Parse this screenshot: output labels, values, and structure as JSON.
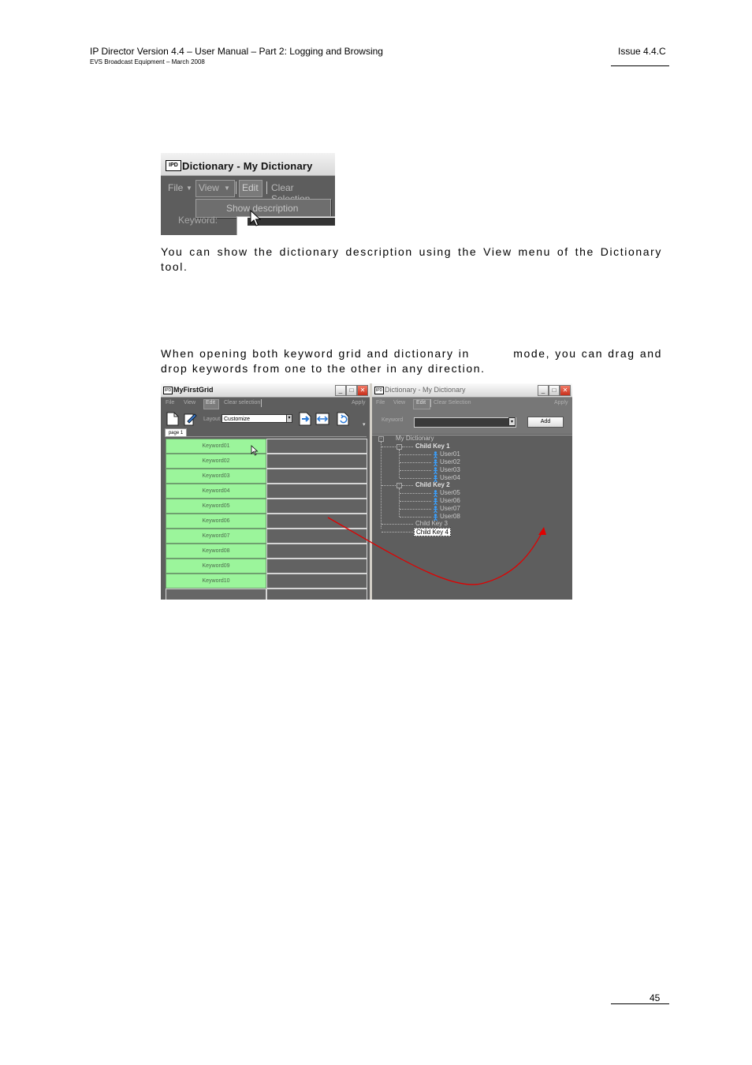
{
  "header": {
    "title": "IP Director Version 4.4 – User Manual – Part 2: Logging and Browsing",
    "subtitle": "EVS Broadcast Equipment – March 2008",
    "issue": "Issue 4.4.C"
  },
  "screenshot1": {
    "window_title": "Dictionary - My Dictionary",
    "logo_text": "IPD",
    "menu": {
      "file": "File",
      "view": "View",
      "edit": "Edit",
      "clear_selection": "Clear Selection"
    },
    "dropdown_item": "Show description",
    "keyword_label": "Keyword:"
  },
  "paragraph1": "You can show the dictionary description using the View menu of the Dictionary tool.",
  "paragraph2": "When opening both keyword grid and dictionary in         mode, you can drag and drop keywords from one to the other in any direction.",
  "screenshot2": {
    "grid_window": {
      "title": "MyFirstGrid",
      "menu": {
        "file": "File",
        "view": "View",
        "edit": "Edit",
        "clear_selection": "Clear selection",
        "apply": "Apply"
      },
      "layout_label": "Layout",
      "layout_value": "Customize",
      "page_tab": "page 1",
      "keywords": [
        "Keyword01",
        "Keyword02",
        "Keyword03",
        "Keyword04",
        "Keyword05",
        "Keyword06",
        "Keyword07",
        "Keyword08",
        "Keyword09",
        "Keyword10"
      ]
    },
    "dictionary_window": {
      "title": "Dictionary - My Dictionary",
      "menu": {
        "file": "File",
        "view": "View",
        "edit": "Edit",
        "clear_selection": "Clear Selection",
        "apply": "Apply"
      },
      "keyword_label": "Keyword",
      "add_button": "Add",
      "root": "My Dictionary",
      "child_key_1": "Child Key 1",
      "child_key_1_users": [
        "User01",
        "User02",
        "User03",
        "User04"
      ],
      "child_key_2": "Child Key 2",
      "child_key_2_users": [
        "User05",
        "User06",
        "User07",
        "User08"
      ],
      "child_key_3": "Child Key 3",
      "child_key_4": "Child Key 4"
    },
    "colors": {
      "grid_cell": "#9bf59b",
      "panel_bg": "#5e5e5e",
      "drag_arrow": "#e00000",
      "user_icon": "#3aa0ff"
    }
  },
  "footer": {
    "page_number": "45"
  }
}
